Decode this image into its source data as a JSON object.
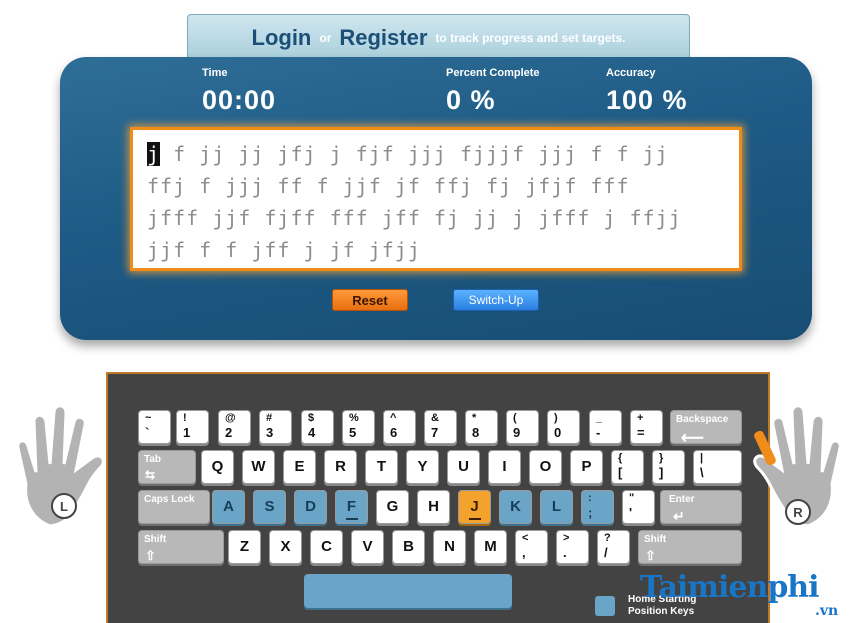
{
  "header": {
    "login": "Login",
    "or": "or",
    "register": "Register",
    "tagline": "to track progress and set targets."
  },
  "stats": {
    "time_label": "Time",
    "time_value": "00:00",
    "percent_label": "Percent Complete",
    "percent_value": "0 %",
    "accuracy_label": "Accuracy",
    "accuracy_value": "100 %"
  },
  "typing_text": {
    "current_char": "j",
    "line1_rest": " f jj jj jfj j fjf jjj fjjjf jjj f f jj",
    "line2": "ffj f jjj ff f jjf jf ffj fj jfjf fff",
    "line3": "jfff jjf fjff fff jff fj jj j jfff j ffjj",
    "line4": "jjf f f jff j jf jfjj"
  },
  "buttons": {
    "reset": "Reset",
    "switch_up": "Switch-Up"
  },
  "keyboard": {
    "row1": [
      {
        "top": "~",
        "bottom": "`"
      },
      {
        "top": "!",
        "bottom": "1"
      },
      {
        "top": "@",
        "bottom": "2"
      },
      {
        "top": "#",
        "bottom": "3"
      },
      {
        "top": "$",
        "bottom": "4"
      },
      {
        "top": "%",
        "bottom": "5"
      },
      {
        "top": "^",
        "bottom": "6"
      },
      {
        "top": "&",
        "bottom": "7"
      },
      {
        "top": "*",
        "bottom": "8"
      },
      {
        "top": "(",
        "bottom": "9"
      },
      {
        "top": ")",
        "bottom": "0"
      },
      {
        "top": "_",
        "bottom": "-"
      },
      {
        "top": "+",
        "bottom": "="
      }
    ],
    "backspace": "Backspace",
    "tab": "Tab",
    "row2": [
      "Q",
      "W",
      "E",
      "R",
      "T",
      "Y",
      "U",
      "I",
      "O",
      "P"
    ],
    "row2_sym": [
      {
        "top": "{",
        "bottom": "["
      },
      {
        "top": "}",
        "bottom": "]"
      },
      {
        "top": "|",
        "bottom": "\\"
      }
    ],
    "caps_lock": "Caps Lock",
    "row3": [
      "A",
      "S",
      "D",
      "F",
      "G",
      "H",
      "J",
      "K",
      "L"
    ],
    "row3_sym": [
      {
        "top": ":",
        "bottom": ";"
      },
      {
        "top": "\"",
        "bottom": "'"
      }
    ],
    "enter": "Enter",
    "shift_left": "Shift",
    "row4": [
      "Z",
      "X",
      "C",
      "V",
      "B",
      "N",
      "M"
    ],
    "row4_sym": [
      {
        "top": "<",
        "bottom": ","
      },
      {
        "top": ">",
        "bottom": "."
      },
      {
        "top": "?",
        "bottom": "/"
      }
    ],
    "shift_right": "Shift",
    "active_key": "J"
  },
  "hands": {
    "left": "L",
    "right": "R"
  },
  "legend": {
    "text": "Home Starting Position Keys"
  },
  "watermark": {
    "text": "Taimienphi",
    "suffix": ".vn"
  },
  "colors": {
    "panel": "#1d5a85",
    "accent_orange": "#f08c1a",
    "home_key": "#6aa4c6",
    "active_key": "#f3a32c"
  }
}
